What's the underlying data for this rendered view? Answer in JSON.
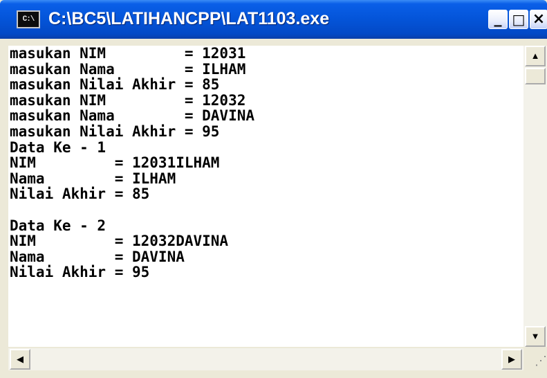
{
  "window": {
    "title": "C:\\BC5\\LATIHANCPP\\LAT1103.exe",
    "icon_text": "C:\\",
    "buttons": {
      "minimize": "_",
      "maximize": "□",
      "close": "×"
    }
  },
  "console": {
    "lines": [
      "masukan NIM         = 12031",
      "masukan Nama        = ILHAM",
      "masukan Nilai Akhir = 85",
      "masukan NIM         = 12032",
      "masukan Nama        = DAVINA",
      "masukan Nilai Akhir = 95",
      "Data Ke - 1",
      "NIM         = 12031ILHAM",
      "Nama        = ILHAM",
      "Nilai Akhir = 85",
      "",
      "Data Ke - 2",
      "NIM         = 12032DAVINA",
      "Nama        = DAVINA",
      "Nilai Akhir = 95"
    ]
  },
  "scrollbars": {
    "up_arrow": "▲",
    "down_arrow": "▼",
    "left_arrow": "◀",
    "right_arrow": "▶",
    "grip": "⋰"
  }
}
